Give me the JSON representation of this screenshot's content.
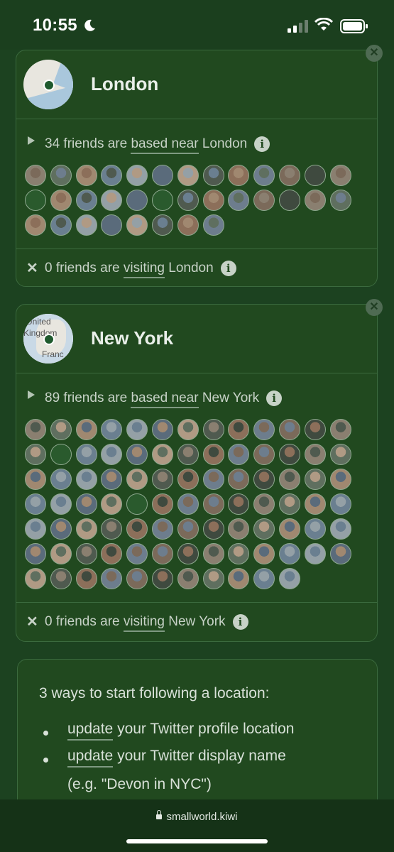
{
  "status": {
    "time": "10:55"
  },
  "cities": [
    {
      "name": "London",
      "based_count": "34 friends are ",
      "based_link": "based near",
      "based_suffix": " London",
      "visiting_prefix": "0 friends are ",
      "visiting_link": "visiting",
      "visiting_suffix": " London",
      "avatar_count": 34
    },
    {
      "name": "New York",
      "map_labels": [
        "United",
        "Kingdom",
        "Franc"
      ],
      "based_count": "89 friends are ",
      "based_link": "based near",
      "based_suffix": " New York",
      "visiting_prefix": "0 friends are ",
      "visiting_link": "visiting",
      "visiting_suffix": " New York",
      "avatar_count": 89
    }
  ],
  "howto": {
    "title": "3 ways to start following a location:",
    "items": [
      {
        "link": "update",
        "text": " your Twitter profile location"
      },
      {
        "link": "update",
        "text": " your Twitter display name"
      }
    ],
    "example": "(e.g. \"Devon in NYC\")"
  },
  "browser": {
    "url": "smallworld.kiwi"
  },
  "colors": {
    "background": "#1c4220",
    "card": "#21491f",
    "border": "#3b6a3e",
    "text": "#e6ece6"
  }
}
